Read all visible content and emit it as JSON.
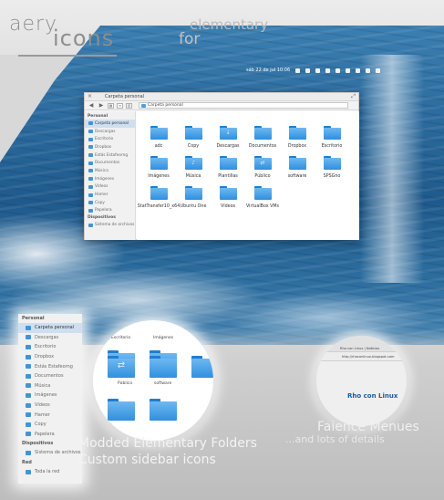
{
  "heading": {
    "brand_left": "aery",
    "brand_right": "icons",
    "for_top": "elementary",
    "for_bottom": "for"
  },
  "panel": {
    "clock": "sáb 22 de jul 10:06"
  },
  "window": {
    "title": "Carpeta personal",
    "path": "Carpeta personal"
  },
  "sidebar_small": {
    "header_personal": "Personal",
    "items": [
      "Carpeta personal",
      "Descargas",
      "Escritorio",
      "Dropbox",
      "Estás Estafeorng",
      "Documentos",
      "Música",
      "Imágenes",
      "Vídeos",
      "Hamer",
      "Copy",
      "Papelera"
    ],
    "header_devices": "Dispositivos",
    "device": "Sistema de archivos"
  },
  "folders": [
    {
      "label": "adc",
      "mark": ""
    },
    {
      "label": "Copy",
      "mark": ""
    },
    {
      "label": "Descargas",
      "mark": "↓"
    },
    {
      "label": "Documentos",
      "mark": ""
    },
    {
      "label": "Dropbox",
      "mark": ""
    },
    {
      "label": "Escritorio",
      "mark": ""
    },
    {
      "label": "Imágenes",
      "mark": ""
    },
    {
      "label": "Música",
      "mark": "♪"
    },
    {
      "label": "Plantillas",
      "mark": ""
    },
    {
      "label": "Público",
      "mark": "⇄"
    },
    {
      "label": "software",
      "mark": ""
    },
    {
      "label": "SPSGno",
      "mark": ""
    },
    {
      "label": "StatTransfer10_x64",
      "mark": ""
    },
    {
      "label": "Ubuntu One",
      "mark": ""
    },
    {
      "label": "Vídeos",
      "mark": ""
    },
    {
      "label": "VirtualBox VMs",
      "mark": ""
    }
  ],
  "sidebar_big": {
    "header_personal": "Personal",
    "items": [
      "Carpeta personal",
      "Descargas",
      "Escritorio",
      "Dropbox",
      "Estás Estafeorng",
      "Documentos",
      "Música",
      "Imágenes",
      "Vídeos",
      "Hamer",
      "Copy",
      "Papelera"
    ],
    "header_devices": "Dispositivos",
    "device": "Sistema de archivos",
    "header_network": "Red",
    "network": "Toda la red"
  },
  "zoom_folders": {
    "top_left": "Escritorio",
    "top_right": "Imágenes",
    "mid_left": "Público",
    "mid_right": "software"
  },
  "zoom_browser": {
    "tab": "Rho con Linux | Noticias",
    "url": "http://rhoconlinux.blogspot.com",
    "heading": "Rho con Linux"
  },
  "captions": {
    "folders": "Modded Elementary Folders",
    "sidebar": "Custom sidebar icons",
    "faience": "Faience Menues",
    "details": "...and lots of details"
  }
}
